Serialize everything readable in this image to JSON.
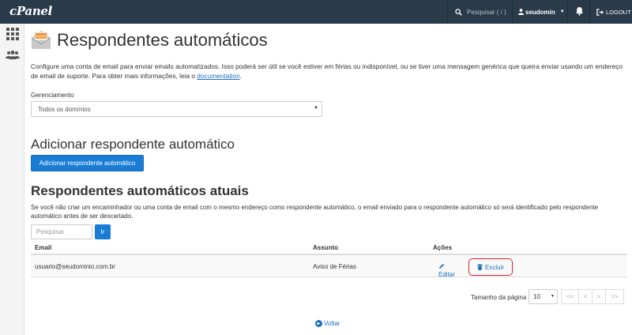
{
  "topbar": {
    "logo": "cPanel",
    "search_placeholder": "Pesquisar ( / )",
    "username": "seudomin",
    "logout_label": "LOGOUT"
  },
  "page": {
    "title": "Respondentes automáticos",
    "icon_badge": "AUTO",
    "description_part1": "Configure uma conta de email para enviar emails automatizados. Isso poderá ser útil se você estiver em férias ou indisponível, ou se tiver uma mensagem genérica que queira enviar usando um endereço de email de suporte. Para obter mais informações, leia o ",
    "description_link": "documentation",
    "description_part2": "."
  },
  "management": {
    "label": "Gerenciamento",
    "selected_domain": "Todos os domínios"
  },
  "add_section": {
    "heading": "Adicionar respondente automático",
    "button_label": "Adicionar respondente automático"
  },
  "current_section": {
    "heading": "Respondentes automáticos atuais",
    "description": "Se você não criar um encaminhador ou uma conta de email com o mesmo endereço como respondente automático, o email enviado para o respondente automático só será identificado pelo respondente automático antes de ser descartado.",
    "search_placeholder": "Pesquisar",
    "go_label": "Ir"
  },
  "table": {
    "headers": {
      "email": "Email",
      "subject": "Assunto",
      "actions": "Ações"
    },
    "rows": [
      {
        "email": "usuario@seudominio.com.br",
        "subject": "Aviso de Férias",
        "edit": "Editar",
        "delete": "Excluir"
      }
    ]
  },
  "pagination": {
    "label": "Tamanho da página",
    "page_size": "10",
    "first": "<<",
    "prev": "<",
    "next": ">",
    "last": ">>"
  },
  "back_link": "Voltar"
}
